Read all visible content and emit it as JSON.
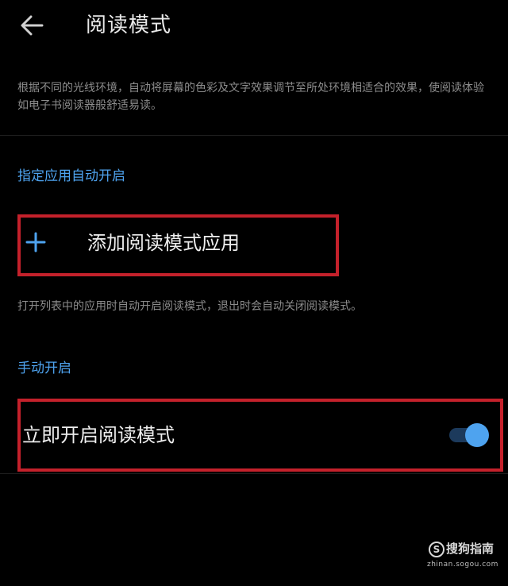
{
  "header": {
    "title": "阅读模式",
    "back_icon": "arrow-left-icon"
  },
  "description": "根据不同的光线环境，自动将屏幕的色彩及文字效果调节至所处环境相适合的效果，使阅读体验如电子书阅读器般舒适易读。",
  "auto_section": {
    "header": "指定应用自动开启",
    "add_label": "添加阅读模式应用",
    "add_icon": "plus-icon",
    "hint": "打开列表中的应用时自动开启阅读模式，退出时会自动关闭阅读模式。"
  },
  "manual_section": {
    "header": "手动开启",
    "toggle_label": "立即开启阅读模式",
    "toggle_on": true
  },
  "watermark": {
    "logo_glyph": "S",
    "text": "搜狗指南",
    "url": "zhinan.sogou.com"
  },
  "colors": {
    "accent": "#4ea3ef",
    "highlight_border": "#c4212b",
    "background": "#000000"
  }
}
